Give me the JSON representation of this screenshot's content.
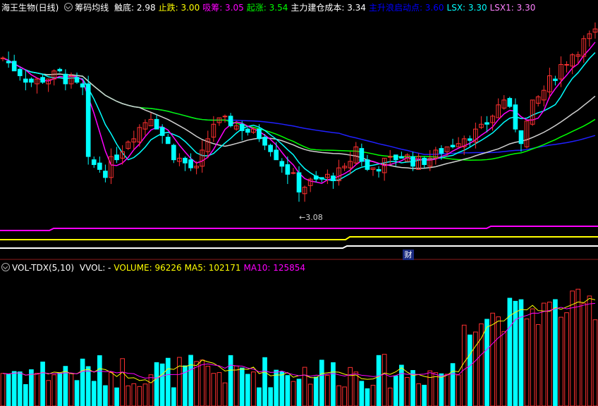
{
  "header": {
    "title": "海王生物(日线)",
    "indicator_name": "筹码均线",
    "items": [
      {
        "label": "触底:",
        "value": "2.98",
        "color": "#ffffff"
      },
      {
        "label": "止跌:",
        "value": "3.00",
        "color": "#ffff00"
      },
      {
        "label": "吸筹:",
        "value": "3.05",
        "color": "#ff00ff"
      },
      {
        "label": "起涨:",
        "value": "3.54",
        "color": "#00ff00"
      },
      {
        "label": "主力建仓成本:",
        "value": "3.34",
        "color": "#ffffff"
      },
      {
        "label": "主升浪启动点:",
        "value": "3.60",
        "color": "#0000ff"
      },
      {
        "label": "LSX:",
        "value": "3.30",
        "color": "#00ffff"
      },
      {
        "label": "LSX1:",
        "value": "3.30",
        "color": "#ff80ff"
      }
    ]
  },
  "vol_header": {
    "name": "VOL-TDX(5,10)",
    "items": [
      {
        "label": "VVOL:",
        "value": "-",
        "color": "#ffffff"
      },
      {
        "label": "VOLUME:",
        "value": "96226",
        "color": "#ffff00"
      },
      {
        "label": "MA5:",
        "value": "102171",
        "color": "#ffff00"
      },
      {
        "label": "MA10:",
        "value": "125854",
        "color": "#ff00ff"
      }
    ]
  },
  "low_marker": "3.08",
  "badge_label": "财",
  "chart_data": {
    "type": "candlestick",
    "price_range": [
      3.0,
      4.2
    ],
    "volume_range": [
      0,
      300000
    ],
    "colors": {
      "up": "#ff3030",
      "down": "#00ffff",
      "ma5": "#ffff00",
      "ma10": "#ff00ff",
      "blue_line": "#2020ff",
      "green_line": "#00ff00",
      "white_line": "#d0d0d0",
      "cyan_line": "#00ffff",
      "magenta_line": "#ff00ff"
    },
    "candles": [],
    "bottom_lines": [
      {
        "name": "magenta",
        "color": "#ff00ff"
      },
      {
        "name": "yellow",
        "color": "#ffff00"
      },
      {
        "name": "white",
        "color": "#ffffff"
      }
    ]
  }
}
